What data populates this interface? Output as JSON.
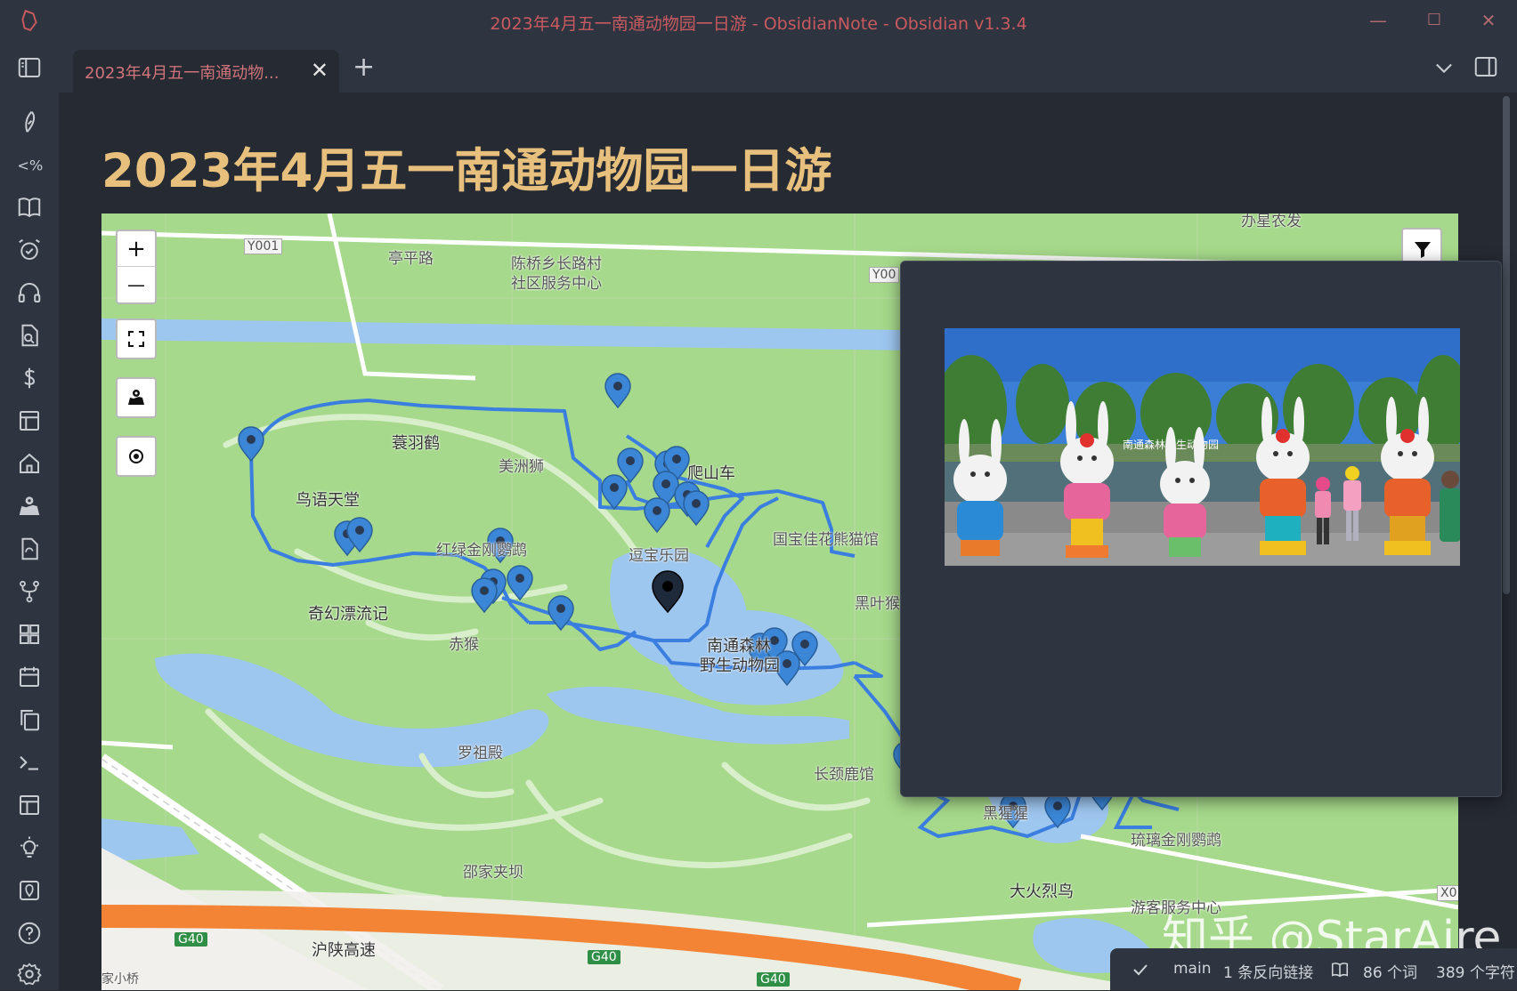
{
  "window": {
    "title": "2023年4月五一南通动物园一日游 - ObsidianNote - Obsidian v1.3.4",
    "minimize": "—",
    "maximize": "☐",
    "close": "✕"
  },
  "tab": {
    "label": "2023年4月五一南通动物...",
    "close": "✕",
    "new": "+"
  },
  "note": {
    "title": "2023年4月五一南通动物园一日游"
  },
  "map": {
    "controls": {
      "zoom_in": "+",
      "zoom_out": "—"
    },
    "labels": {
      "road_y001_left": "Y001",
      "road_y001_right": "Y00",
      "road_x0": "X0",
      "tingping_road": "亭平路",
      "community": "陈桥乡长路村",
      "community2": "社区服务中心",
      "shuying": "蓑羽鹤",
      "meizhoushi": "美洲狮",
      "pashan": "爬山车",
      "niaoyu": "鸟语天堂",
      "honglv": "红绿金刚鹦鹉",
      "doubao": "逗宝乐园",
      "panda": "国宝佳花熊猫馆",
      "qihuan": "奇幻漂流记",
      "chihou": "赤猴",
      "heiye": "黑叶猴",
      "forest1": "南通森林",
      "forest2": "野生动物园",
      "luozu": "罗祖殿",
      "giraffe": "长颈鹿馆",
      "shaojia": "邵家夹坝",
      "hushan": "沪陕高速",
      "liuli": "琉璃金刚鹦鹉",
      "dahuolie": "大火烈鸟",
      "visitor": "游客服务中心",
      "gibbon": "黑猩猩",
      "g40a": "G40",
      "g40b": "G40",
      "g40c": "G40",
      "xiaoqiao": "家小桥",
      "top_right": "办星农发"
    }
  },
  "popover": {
    "photo_sign": "南通森林野生动物园"
  },
  "watermark": "知乎 @StarAire",
  "status": {
    "branch": "main",
    "backlinks": "1 条反向链接",
    "words": "86 个词",
    "chars": "389 个字符"
  },
  "icons": [
    "obsidian-logo-icon",
    "sidebar-toggle-icon",
    "feather-icon",
    "templater-icon",
    "book-icon",
    "alarm-check-icon",
    "headphones-icon",
    "file-search-icon",
    "dollar-icon",
    "layout-icon",
    "home-icon",
    "map-icon",
    "file-sync-icon",
    "git-fork-icon",
    "grid-icon",
    "calendar-icon",
    "copy-icon",
    "terminal-icon",
    "layout-2-icon",
    "lightbulb-icon",
    "map-pin-icon",
    "help-icon",
    "settings-icon",
    "chevron-down-icon",
    "right-sidebar-icon",
    "filter-icon",
    "fullscreen-icon",
    "map-layers-icon",
    "locate-icon",
    "check-icon",
    "book-open-icon"
  ]
}
